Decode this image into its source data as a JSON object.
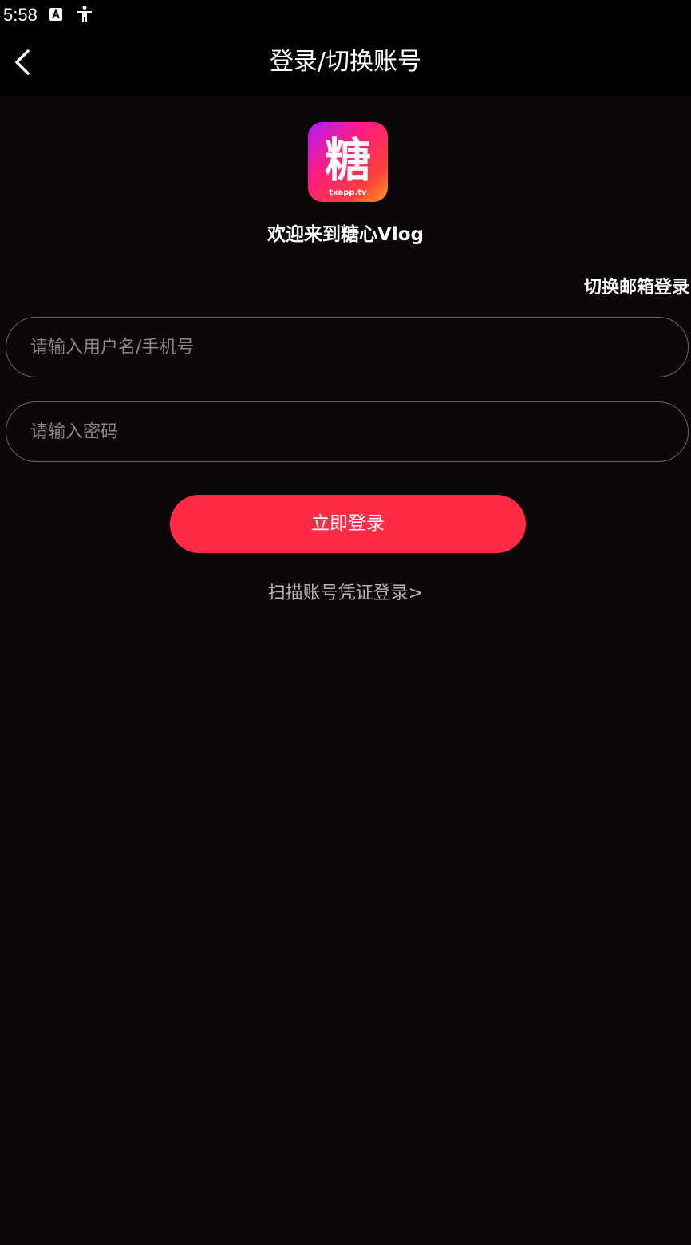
{
  "status_bar": {
    "time": "5:58",
    "icons": [
      "a-notification-icon",
      "accessibility-icon"
    ]
  },
  "header": {
    "title": "登录/切换账号",
    "back_icon": "chevron-left-icon"
  },
  "logo": {
    "char": "糖",
    "domain": "txapp.tv"
  },
  "welcome_text": "欢迎来到糖心Vlog",
  "switch_email_label": "切换邮箱登录",
  "form": {
    "username_placeholder": "请输入用户名/手机号",
    "username_value": "",
    "password_placeholder": "请输入密码",
    "password_value": ""
  },
  "login_button_label": "立即登录",
  "scan_login_label": "扫描账号凭证登录>",
  "colors": {
    "background": "#0b0608",
    "accent": "#ff2b45",
    "field_border": "#6a6468",
    "placeholder": "#8b8589",
    "muted_text": "#b9b3b7"
  }
}
